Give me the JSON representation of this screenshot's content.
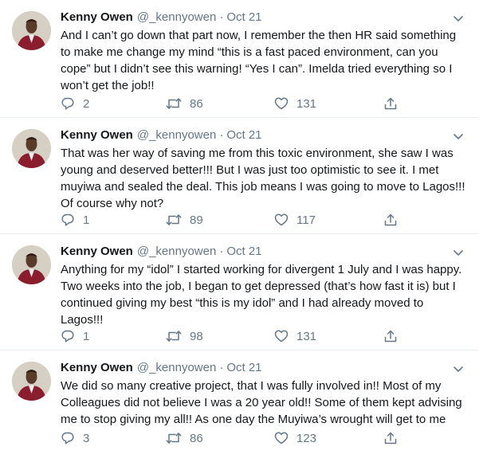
{
  "tweets": [
    {
      "name": "Kenny Owen",
      "handle": "@_kennyowen",
      "separator": "·",
      "date": "Oct 21",
      "lines": [
        "And I can’t go down that part now, I remember the then HR said something",
        "to make me change my mind “this is a fast paced environment, can you",
        "cope” but I didn’t see this warning! “Yes I can”. Imelda tried everything so I",
        "won’t get the job!!"
      ],
      "replies": "2",
      "retweets": "86",
      "likes": "131"
    },
    {
      "name": "Kenny Owen",
      "handle": "@_kennyowen",
      "separator": "·",
      "date": "Oct 21",
      "lines": [
        "That was her way of saving me from this toxic environment, she saw I was",
        "young and deserved better!!! But I was just too optimistic to see it. I met",
        "muyiwa and sealed the deal. This job means I was going to move to Lagos!!!",
        "Of course why not?"
      ],
      "replies": "1",
      "retweets": "89",
      "likes": "117"
    },
    {
      "name": "Kenny Owen",
      "handle": "@_kennyowen",
      "separator": "·",
      "date": "Oct 21",
      "lines": [
        "Anything for my “idol” I started working for divergent 1 July and I was happy.",
        "Two weeks into the job, I began to get depressed (that’s how fast it is) but I",
        "continued giving my best “this is my idol” and I had already moved to",
        "Lagos!!!"
      ],
      "replies": "1",
      "retweets": "98",
      "likes": "131"
    },
    {
      "name": "Kenny Owen",
      "handle": "@_kennyowen",
      "separator": "·",
      "date": "Oct 21",
      "lines": [
        "We did so many creative project, that I was fully involved in!! Most of my",
        "Colleagues did not believe I was a 20 year old!! Some of them kept advising",
        "me to stop giving my all!! As one day the Muyiwa’s wrought will get to me"
      ],
      "replies": "3",
      "retweets": "86",
      "likes": "123"
    }
  ],
  "icons": {
    "reply": "reply-icon",
    "retweet": "retweet-icon",
    "like": "like-icon",
    "share": "share-icon",
    "more": "chevron-down-icon",
    "avatar": "avatar"
  },
  "colors": {
    "text": "#14171a",
    "secondary": "#657786",
    "divider": "#e6ecf0",
    "suit": "#8b1e2e"
  }
}
